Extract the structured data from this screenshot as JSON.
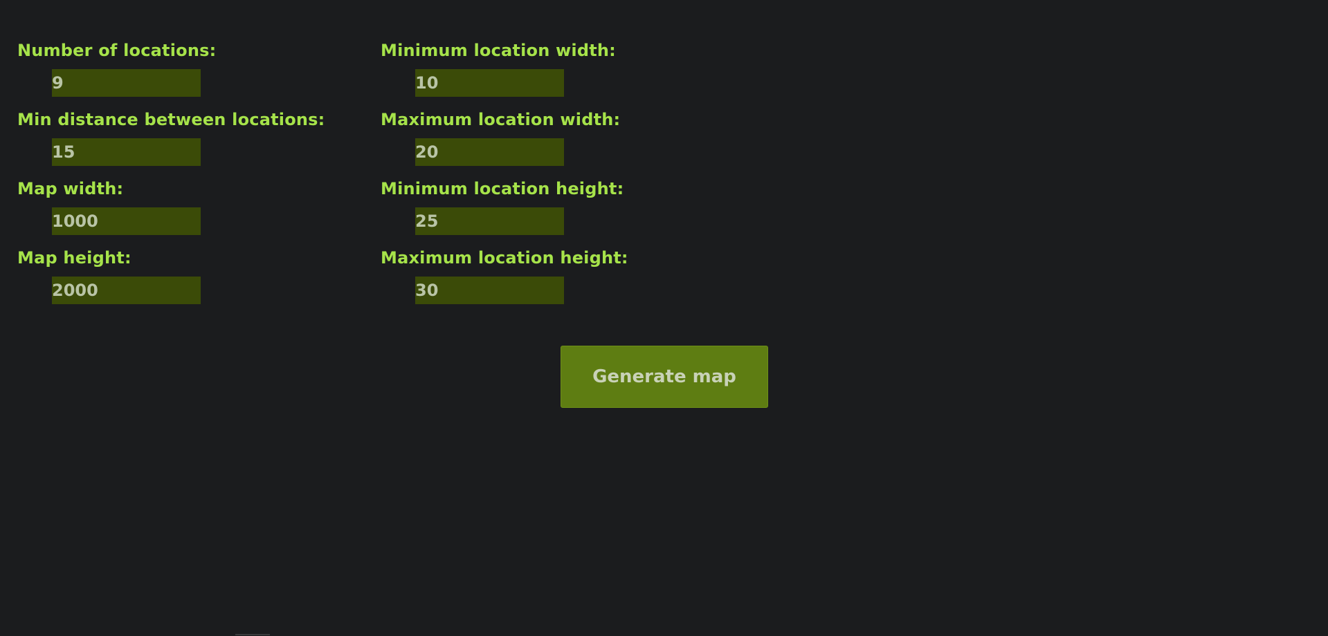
{
  "form": {
    "fields": [
      {
        "label": "Number of locations:",
        "value": "9"
      },
      {
        "label": "Min distance between locations:",
        "value": "15"
      },
      {
        "label": "Map width:",
        "value": "1000"
      },
      {
        "label": "Map height:",
        "value": "2000"
      },
      {
        "label": "Minimum location width:",
        "value": "10"
      },
      {
        "label": "Maximum location width:",
        "value": "20"
      },
      {
        "label": "Minimum location height:",
        "value": "25"
      },
      {
        "label": "Maximum location height:",
        "value": "30"
      }
    ],
    "generate_label": "Generate map"
  },
  "colors": {
    "background": "#1b1c1e",
    "label": "#a6e34a",
    "input_background": "#3b4b08",
    "input_text": "#b9c4a6",
    "button_background": "#5e7d12",
    "button_text": "#c9d2b7"
  }
}
